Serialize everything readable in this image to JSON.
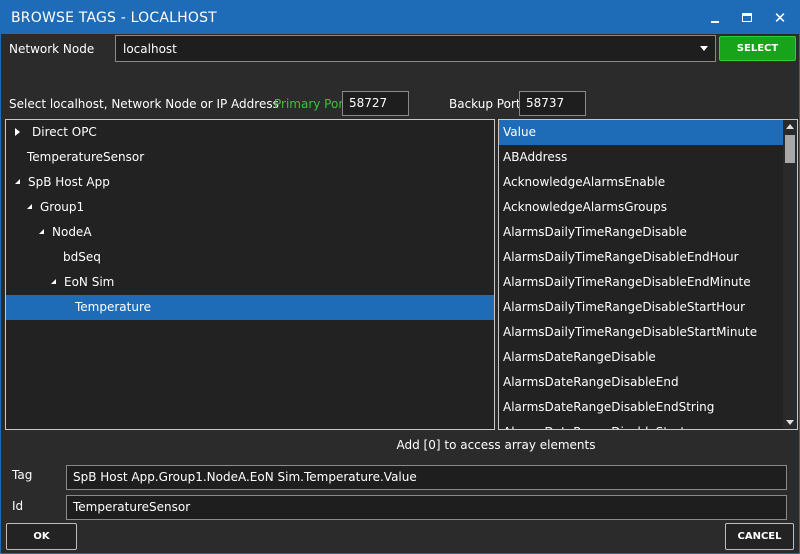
{
  "window": {
    "title": "BROWSE TAGS - LOCALHOST"
  },
  "network": {
    "label": "Network Node",
    "value": "localhost",
    "select_label": "SELECT"
  },
  "ports": {
    "instruction": "Select localhost, Network Node or IP Address",
    "primary_label": "Primary Port",
    "primary_value": "58727",
    "backup_label": "Backup Port",
    "backup_value": "58737"
  },
  "tree": [
    {
      "label": "Direct OPC",
      "expander": "collapsed",
      "level": 0,
      "selected": false
    },
    {
      "label": "TemperatureSensor",
      "expander": "none",
      "level": 0,
      "selected": false
    },
    {
      "label": "SpB Host App",
      "expander": "expanded",
      "level": 0,
      "selected": false
    },
    {
      "label": "Group1",
      "expander": "expanded",
      "level": 1,
      "selected": false
    },
    {
      "label": "NodeA",
      "expander": "expanded",
      "level": 2,
      "selected": false
    },
    {
      "label": "bdSeq",
      "expander": "none",
      "level": 3,
      "selected": false
    },
    {
      "label": "EoN Sim",
      "expander": "expanded",
      "level": 3,
      "selected": false
    },
    {
      "label": "Temperature",
      "expander": "none",
      "level": 4,
      "selected": true
    }
  ],
  "properties": [
    "Value",
    "ABAddress",
    "AcknowledgeAlarmsEnable",
    "AcknowledgeAlarmsGroups",
    "AlarmsDailyTimeRangeDisable",
    "AlarmsDailyTimeRangeDisableEndHour",
    "AlarmsDailyTimeRangeDisableEndMinute",
    "AlarmsDailyTimeRangeDisableStartHour",
    "AlarmsDailyTimeRangeDisableStartMinute",
    "AlarmsDateRangeDisable",
    "AlarmsDateRangeDisableEnd",
    "AlarmsDateRangeDisableEndString",
    "AlarmsDateRangeDisableStart"
  ],
  "selected_property": "Value",
  "hint": "Add [0] to access array elements",
  "tag": {
    "label": "Tag",
    "value": "SpB Host App.Group1.NodeA.EoN Sim.Temperature.Value"
  },
  "id": {
    "label": "Id",
    "value": "TemperatureSensor"
  },
  "buttons": {
    "ok": "OK",
    "cancel": "CANCEL"
  },
  "colors": {
    "accent": "#1e6bb8",
    "select_green": "#17a31a",
    "primary_port_label": "#3cc23c",
    "background": "#2b2b2b"
  }
}
